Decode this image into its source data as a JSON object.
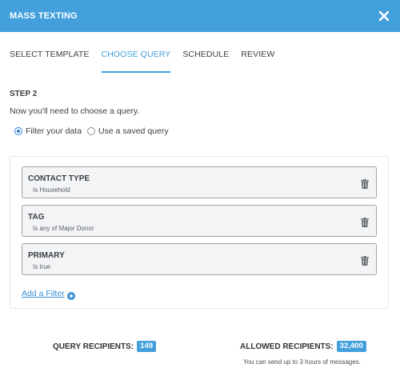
{
  "header": {
    "title": "MASS TEXTING",
    "close_icon": "close-icon",
    "color": "#43a0dc"
  },
  "tabs": [
    {
      "label": "SELECT TEMPLATE",
      "active": false
    },
    {
      "label": "CHOOSE QUERY",
      "active": true
    },
    {
      "label": "SCHEDULE",
      "active": false
    },
    {
      "label": "REVIEW",
      "active": false
    }
  ],
  "step": {
    "label": "STEP 2",
    "description": "Now you'll need to choose a query."
  },
  "query_mode": {
    "options": [
      {
        "label": "Filter your data",
        "checked": true
      },
      {
        "label": "Use a saved query",
        "checked": false
      }
    ]
  },
  "filters": [
    {
      "name": "CONTACT TYPE",
      "value": "Is Household",
      "icon": "trash-icon"
    },
    {
      "name": "TAG",
      "value": "Is any of Major Donor",
      "icon": "trash-icon"
    },
    {
      "name": "PRIMARY",
      "value": "Is true",
      "icon": "trash-icon"
    }
  ],
  "add_filter": {
    "label": "Add a Filter",
    "icon": "plus-circle-icon"
  },
  "recipients": {
    "query_label": "QUERY RECIPIENTS:",
    "query_count": "149",
    "allowed_label": "ALLOWED RECIPIENTS:",
    "allowed_count": "32,400",
    "note": "You can send up to 3 hours of messages."
  }
}
